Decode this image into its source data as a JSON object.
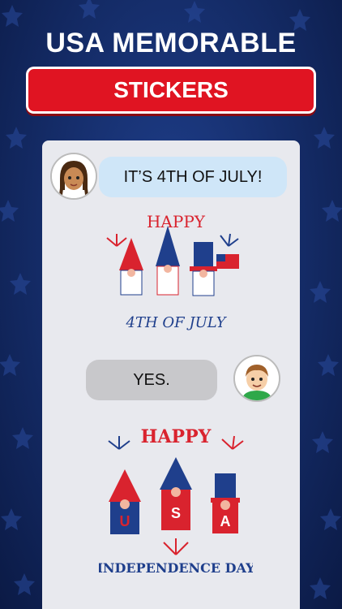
{
  "header": {
    "title": "USA MEMORABLE",
    "banner": "STICKERS"
  },
  "chat": {
    "messages": [
      {
        "text": "IT’S 4TH OF JULY!"
      },
      {
        "text": "YES."
      }
    ],
    "sticker1": {
      "top": "HAPPY",
      "bottom": "4TH OF JULY"
    },
    "sticker2": {
      "top": "HAPPY",
      "bottom": "INDEPENDENCE DAY",
      "letters": [
        "U",
        "S",
        "A"
      ]
    }
  },
  "colors": {
    "red": "#e01422",
    "blue": "#1f3f8c",
    "navy": "#142b66"
  }
}
